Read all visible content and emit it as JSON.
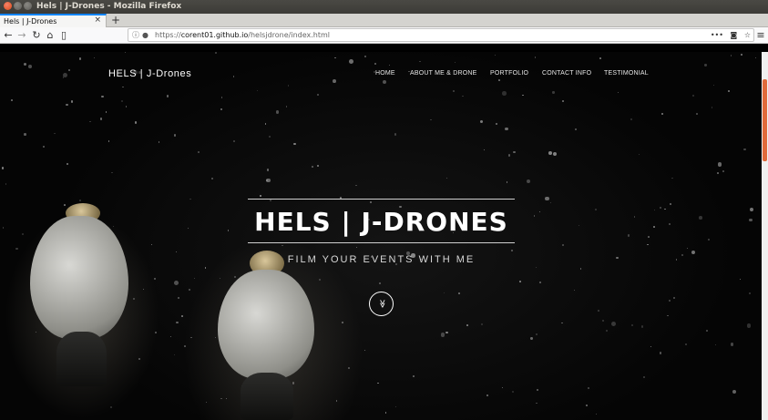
{
  "window": {
    "title": "Hels | J-Drones - Mozilla Firefox"
  },
  "tabs": [
    {
      "label": "Hels | J-Drones",
      "close": "×"
    }
  ],
  "toolbar": {
    "new_tab": "+",
    "back": "←",
    "forward": "→",
    "reload": "↻",
    "home": "⌂",
    "library": "▯",
    "menu": "≡"
  },
  "urlbar": {
    "info": "ⓘ",
    "lock": "🔒",
    "scheme": "https://",
    "host": "corent01.github.io",
    "path": "/helsjdrone/index.html",
    "more": "•••",
    "pocket": "◙",
    "bookmark": "☆"
  },
  "site": {
    "brand": "HELS | J-Drones",
    "nav": [
      "HOME",
      "ABOUT ME & DRONE",
      "PORTFOLIO",
      "CONTACT INFO",
      "TESTIMONIAL"
    ],
    "hero_title": "HELS | J-DRONES",
    "hero_subtitle": "FILM YOUR EVENTS WITH ME",
    "scroll_icon": "≫"
  },
  "icons": {
    "close": "close-icon",
    "minimize": "minimize-icon",
    "maximize": "maximize-icon",
    "scroll_down": "double-chevron-down-icon"
  },
  "colors": {
    "accent": "#0a84ff",
    "scroll_thumb": "#e06a3b",
    "hero_bg": "#050505"
  }
}
